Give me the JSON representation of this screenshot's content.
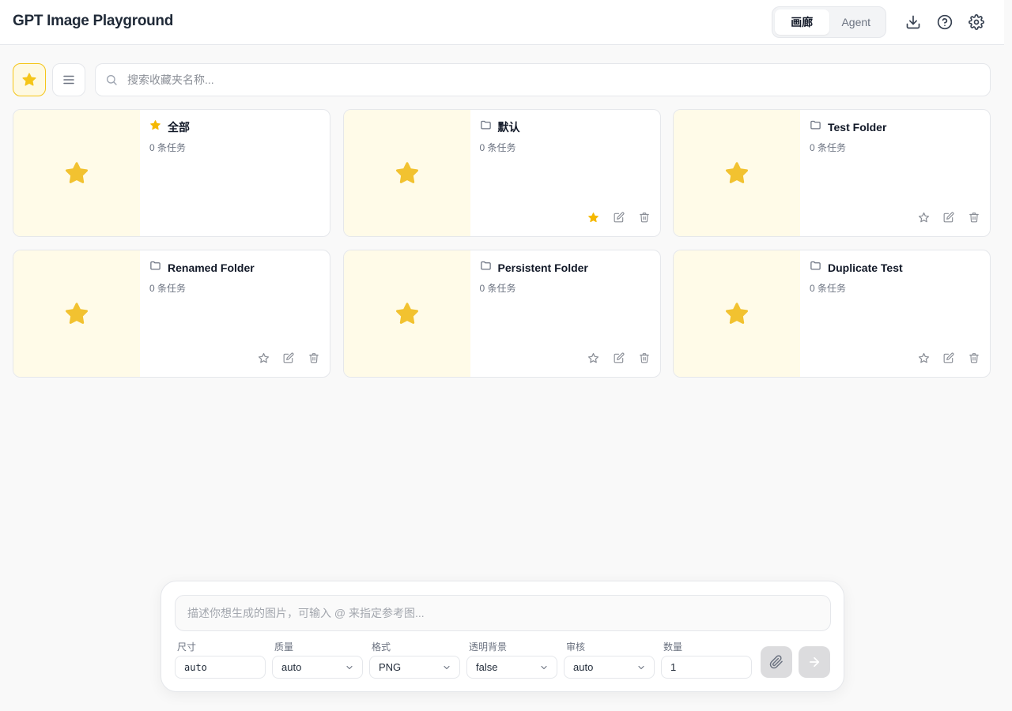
{
  "app": {
    "title": "GPT Image Playground",
    "tabs": [
      {
        "label": "画廊",
        "active": true
      },
      {
        "label": "Agent",
        "active": false
      }
    ],
    "header_icons": [
      "download-icon",
      "help-icon",
      "settings-icon"
    ]
  },
  "toolbar": {
    "favorites_icon": "star-icon",
    "list_icon": "list-icon",
    "search_placeholder": "搜索收藏夹名称..."
  },
  "folders": [
    {
      "name": "全部",
      "count": "0 条任务",
      "icon": "star-icon",
      "starred": true,
      "show_actions": false
    },
    {
      "name": "默认",
      "count": "0 条任务",
      "icon": "folder-icon",
      "starred": true,
      "show_actions": true
    },
    {
      "name": "Test Folder",
      "count": "0 条任务",
      "icon": "folder-icon",
      "starred": false,
      "show_actions": true
    },
    {
      "name": "Renamed Folder",
      "count": "0 条任务",
      "icon": "folder-icon",
      "starred": false,
      "show_actions": true
    },
    {
      "name": "Persistent Folder",
      "count": "0 条任务",
      "icon": "folder-icon",
      "starred": false,
      "show_actions": true
    },
    {
      "name": "Duplicate Test",
      "count": "0 条任务",
      "icon": "folder-icon",
      "starred": false,
      "show_actions": true
    }
  ],
  "composer": {
    "prompt_placeholder": "描述你想生成的图片，可输入 @ 来指定参考图...",
    "fields": [
      {
        "label": "尺寸",
        "value": "auto"
      },
      {
        "label": "质量",
        "value": "auto"
      },
      {
        "label": "格式",
        "value": "PNG"
      },
      {
        "label": "透明背景",
        "value": "false"
      },
      {
        "label": "审核",
        "value": "auto"
      },
      {
        "label": "数量",
        "value": "1"
      }
    ]
  },
  "colors": {
    "accent_star": "#f5c518",
    "thumb_bg": "#fffbe8",
    "border": "#e5e7eb"
  }
}
